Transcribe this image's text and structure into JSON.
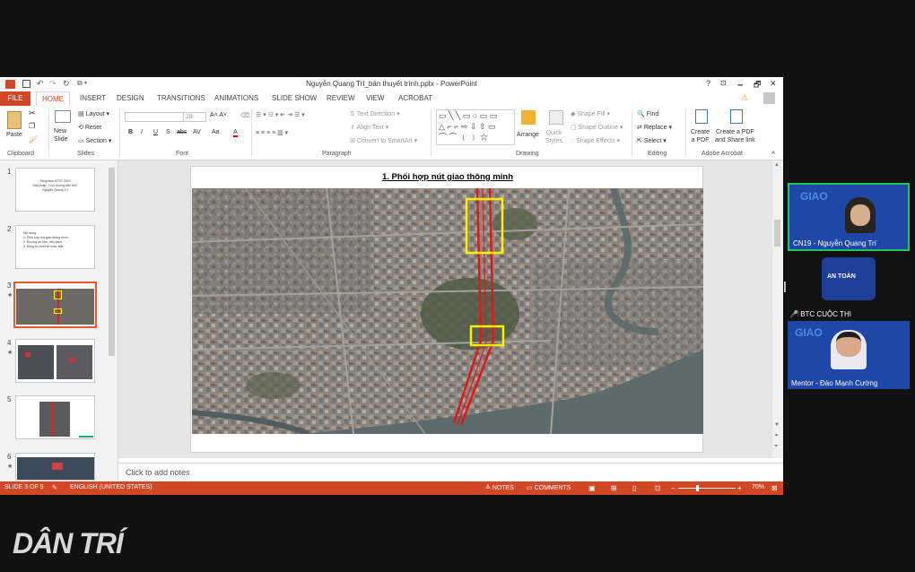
{
  "window": {
    "title": "Nguyễn Quang Trí_bản thuyết trình.pptx - PowerPoint",
    "help": "?",
    "controls": [
      "🗕",
      "🗗",
      "✕"
    ]
  },
  "ribbon_tabs": [
    "FILE",
    "HOME",
    "INSERT",
    "DESIGN",
    "TRANSITIONS",
    "ANIMATIONS",
    "SLIDE SHOW",
    "REVIEW",
    "VIEW",
    "ACROBAT"
  ],
  "ribbon": {
    "clipboard": {
      "paste": "Paste",
      "label": "Clipboard"
    },
    "slides": {
      "new_slide": "New\nSlide",
      "layout": "Layout",
      "reset": "Reset",
      "section": "Section",
      "label": "Slides"
    },
    "font": {
      "size": "28",
      "label": "Font",
      "buttons": [
        "B",
        "I",
        "U",
        "S",
        "abc",
        "AV",
        "Aa",
        "A"
      ]
    },
    "paragraph": {
      "text_direction": "Text Direction",
      "align_text": "Align Text",
      "smartart": "Convert to SmartArt",
      "label": "Paragraph"
    },
    "drawing": {
      "arrange": "Arrange",
      "quick_styles": "Quick\nStyles",
      "shape_fill": "Shape Fill",
      "shape_outline": "Shape Outline",
      "shape_effects": "Shape Effects",
      "label": "Drawing"
    },
    "editing": {
      "find": "Find",
      "replace": "Replace",
      "select": "Select",
      "label": "Editing"
    },
    "acrobat": {
      "create_pdf": "Create\na PDF",
      "create_share": "Create a PDF\nand Share link",
      "label": "Adobe Acrobat"
    }
  },
  "slides": [
    {
      "num": "1",
      "lines": [
        "Sáng kiến ATGT 2024",
        "Giải pháp: \"Con đường đèn trời\"",
        "",
        "Nguyễn Quang Trí"
      ]
    },
    {
      "num": "2",
      "lines": [
        "Nội dung",
        "1. Phối hợp nút giao thông minh",
        "2. Đường ưu tiên, đèn xanh",
        "3. Đồng bộ thiết kế khác biệt"
      ]
    },
    {
      "num": "3",
      "star": "★"
    },
    {
      "num": "4",
      "star": "★"
    },
    {
      "num": "5"
    },
    {
      "num": "6",
      "star": "★"
    }
  ],
  "current_slide": {
    "title": "1. Phối hợp nút giao thông minh"
  },
  "notes_placeholder": "Click to add notes",
  "status": {
    "slide_of": "SLIDE 3 OF 9",
    "language": "ENGLISH (UNITED STATES)",
    "notes": "NOTES",
    "comments": "COMMENTS",
    "zoom": "70%"
  },
  "participants": [
    {
      "name": "CN19 - Nguyễn Quang Trí",
      "active": true
    },
    {
      "name": "BTC CUỘC THI",
      "muted": true
    },
    {
      "name": "Mentor - Đào Mạnh Cường"
    }
  ],
  "watermark": "DÂN TRÍ",
  "colors": {
    "accent": "#d24726",
    "active_speaker": "#22c55e"
  }
}
